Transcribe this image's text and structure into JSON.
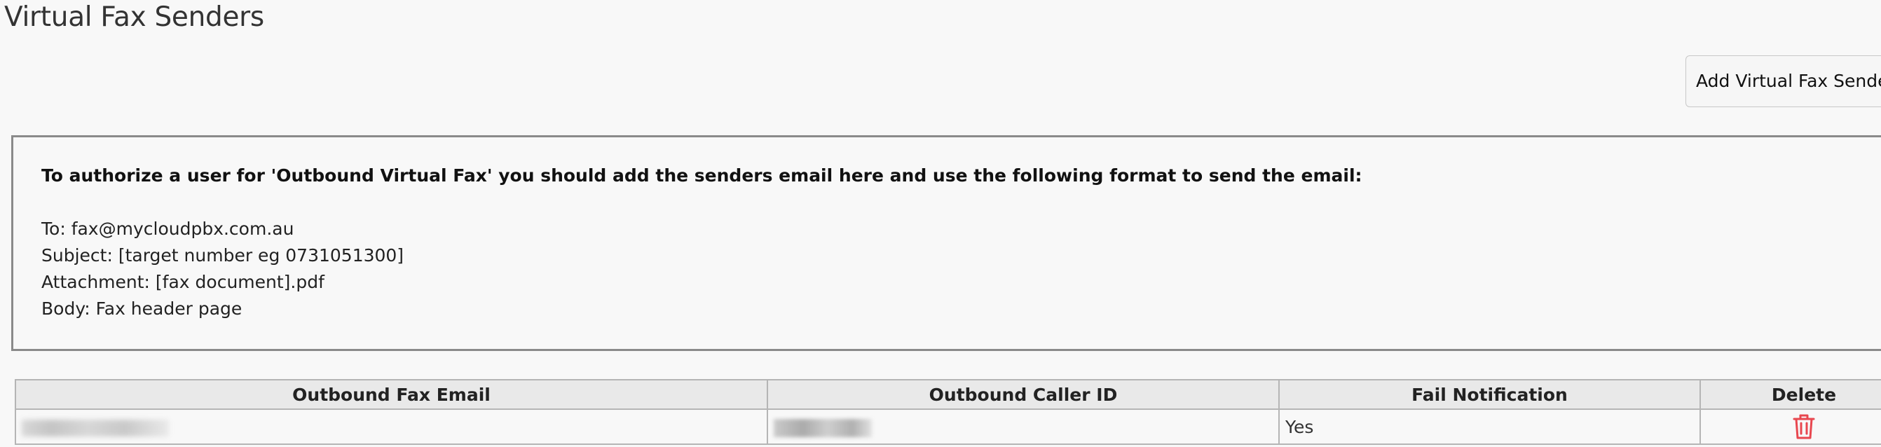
{
  "page": {
    "title": "Virtual Fax Senders"
  },
  "toolbar": {
    "add_label": "Add Virtual Fax Sender"
  },
  "info": {
    "heading": "To authorize a user for 'Outbound Virtual Fax' you should add the senders email here and use the following format to send the email:",
    "lines": [
      "To: fax@mycloudpbx.com.au",
      "Subject: [target number eg 0731051300]",
      "Attachment: [fax document].pdf",
      "Body: Fax header page"
    ]
  },
  "table": {
    "columns": [
      "Outbound Fax Email",
      "Outbound Caller ID",
      "Fail Notification",
      "Delete"
    ],
    "rows": [
      {
        "fail_notification": "Yes",
        "delete_icon": "trash-icon"
      }
    ]
  },
  "colors": {
    "delete_icon": "#e8474f",
    "header_bg": "#e9e9e9",
    "border": "#b5b5b5"
  }
}
